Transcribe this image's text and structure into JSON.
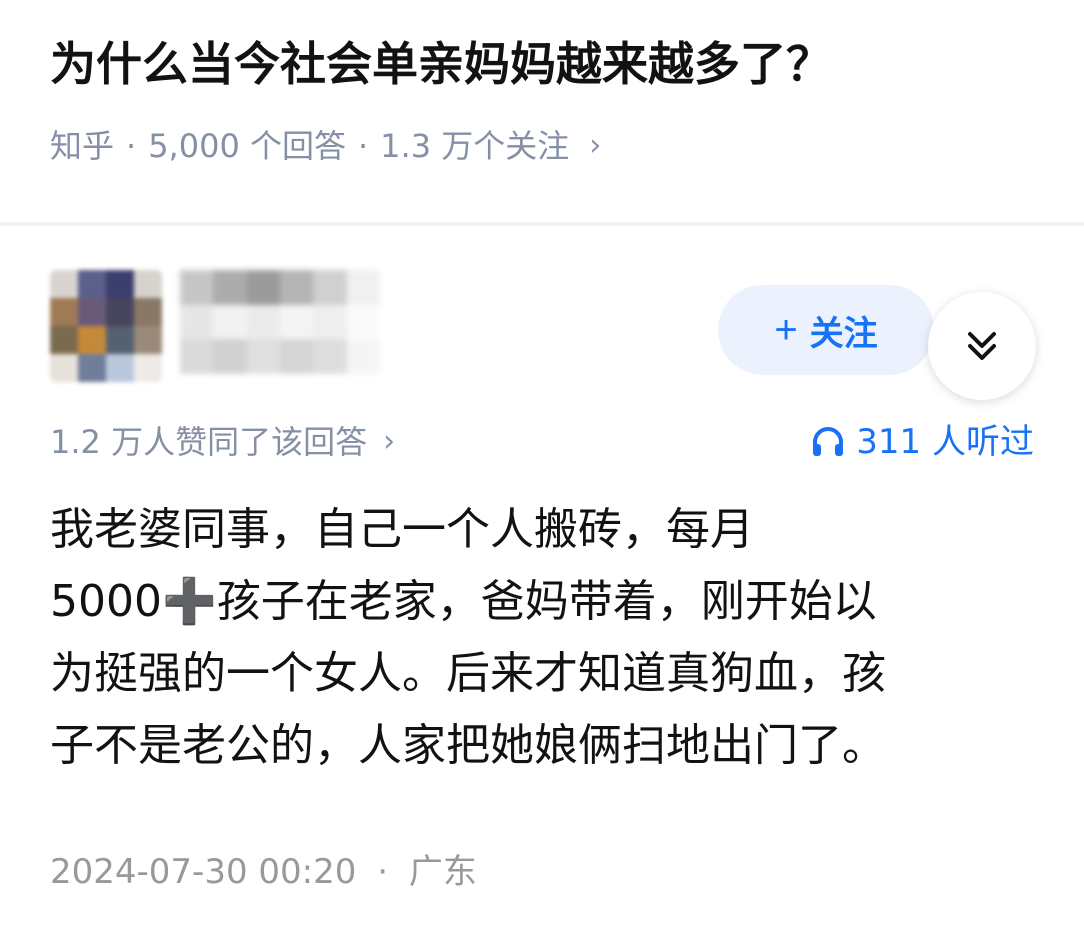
{
  "question": {
    "title": "为什么当今社会单亲妈妈越来越多了？",
    "source": "知乎",
    "answers": "5,000 个回答",
    "followers": "1.3 万个关注",
    "chevron": "›"
  },
  "author": {
    "follow_icon": "+",
    "follow_label": "关注"
  },
  "stats": {
    "upvotes": "1.2 万人赞同了该回答",
    "chevron": "›",
    "listen_icon": "headphones-icon",
    "listeners": "311 人听过"
  },
  "answer": {
    "lines": [
      "我老婆同事，自己一个人搬砖，每月",
      "5000➕孩子在老家，爸妈带着，刚开始以",
      "为挺强的一个女人。后来才知道真狗血，孩",
      "子不是老公的，人家把她娘俩扫地出门了。"
    ]
  },
  "footer": {
    "datetime": "2024-07-30 00:20",
    "dot": "·",
    "location": "广东"
  },
  "colors": {
    "accent": "#1772f6",
    "meta": "#8590a6",
    "follow_bg": "#ebf2fe"
  }
}
